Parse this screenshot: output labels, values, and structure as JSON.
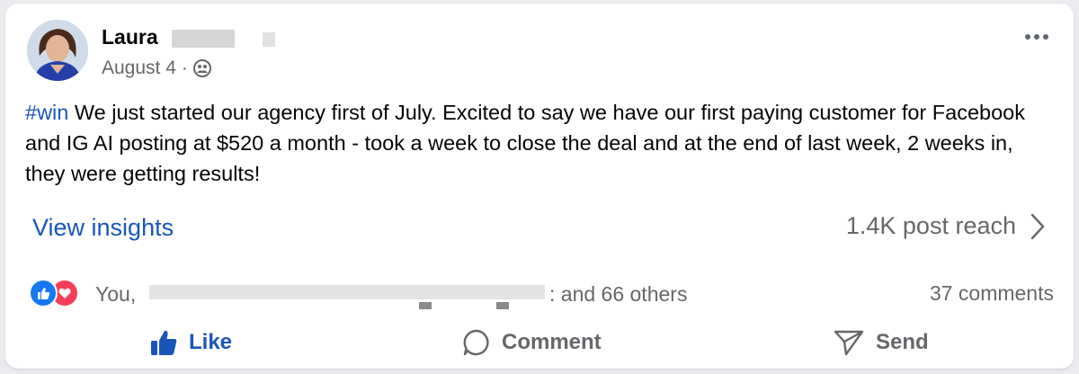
{
  "post": {
    "author_name": "Laura",
    "date": "August 4",
    "separator": "·",
    "privacy_icon": "group-icon",
    "more_icon": "more-horizontal-icon",
    "hashtag": "#win",
    "body": " We just started our agency first of July. Excited to say we have our first paying customer for Facebook and IG AI posting at $520 a month - took a week to close the deal and at the end of last week, 2 weeks in, they were getting results!"
  },
  "insights": {
    "view_label": "View insights",
    "reach_label": "1.4K post reach"
  },
  "engagement": {
    "reactions_prefix": "You, ",
    "reactions_suffix": ": and 66 others",
    "comments_label": "37 comments"
  },
  "actions": {
    "like_label": "Like",
    "comment_label": "Comment",
    "send_label": "Send"
  },
  "colors": {
    "link_blue": "#1a56b8",
    "like_blue": "#1877f2",
    "love_red": "#f33e58",
    "secondary_text": "#65676b"
  }
}
